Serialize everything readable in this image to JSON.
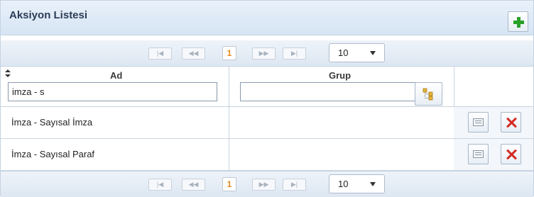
{
  "panel": {
    "title": "Aksiyon Listesi",
    "add_icon": "plus-icon"
  },
  "pager": {
    "first": "|◀",
    "prev": "◀◀",
    "current_page": "1",
    "next": "▶▶",
    "last": "▶|",
    "page_size": "10"
  },
  "columns": [
    {
      "label": "Ad",
      "filter_value": "imza - s",
      "sortable": true
    },
    {
      "label": "Grup",
      "filter_value": "",
      "filter_icon": "tree-select-icon"
    }
  ],
  "rows": [
    {
      "ad": "İmza - Sayısal İmza",
      "grup": "",
      "edit_icon": "edit-icon",
      "delete_icon": "delete-icon"
    },
    {
      "ad": "İmza - Sayısal Paraf",
      "grup": "",
      "edit_icon": "edit-icon",
      "delete_icon": "delete-icon"
    }
  ],
  "colors": {
    "accent_add": "#2aa12a",
    "delete": "#d42a22",
    "current_page": "#e8891a"
  }
}
